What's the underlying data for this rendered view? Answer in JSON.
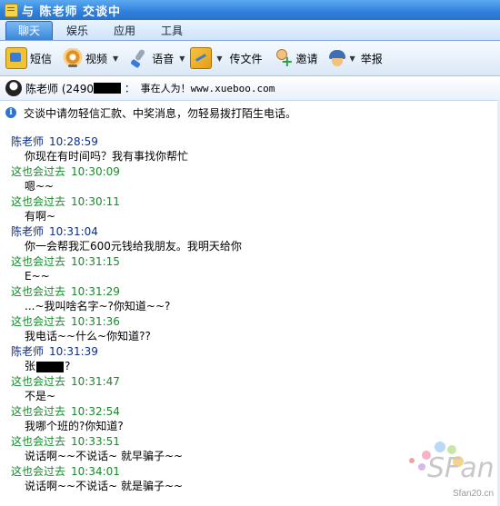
{
  "window": {
    "title": "与 陈老师 交谈中"
  },
  "tabs": [
    "聊天",
    "娱乐",
    "应用",
    "工具"
  ],
  "toolbar": {
    "sms": "短信",
    "video": "视频",
    "voice": "语音",
    "file": "传文件",
    "invite": "邀请",
    "report": "举报"
  },
  "contact": {
    "name_prefix": "陈老师 (2490",
    "sign": "：  事在人为！www.xueboo.com"
  },
  "warning": "交谈中请勿轻信汇款、中奖消息，勿轻易拨打陌生电话。",
  "colors": {
    "teacher": "#0a2e8a",
    "me": "#1a8a2e"
  },
  "messages": [
    {
      "sender": "陈老师",
      "time": "10:28:59",
      "side": "teacher",
      "text": "你现在有时间吗？我有事找你帮忙"
    },
    {
      "sender": "这也会过去",
      "time": "10:30:09",
      "side": "me",
      "text": "嗯~~"
    },
    {
      "sender": "这也会过去",
      "time": "10:30:11",
      "side": "me",
      "text": "有啊~"
    },
    {
      "sender": "陈老师",
      "time": "10:31:04",
      "side": "teacher",
      "text": "你一会帮我汇600元钱给我朋友。我明天给你"
    },
    {
      "sender": "这也会过去",
      "time": "10:31:15",
      "side": "me",
      "text": "E~~"
    },
    {
      "sender": "这也会过去",
      "time": "10:31:29",
      "side": "me",
      "text": "...~我叫啥名字~?你知道~~?"
    },
    {
      "sender": "这也会过去",
      "time": "10:31:36",
      "side": "me",
      "text": "我电话~~什么~你知道??"
    },
    {
      "sender": "陈老师",
      "time": "10:31:39",
      "side": "teacher",
      "text_prefix": "张",
      "text_suffix": "?"
    },
    {
      "sender": "这也会过去",
      "time": "10:31:47",
      "side": "me",
      "text": "不是~"
    },
    {
      "sender": "这也会过去",
      "time": "10:32:54",
      "side": "me",
      "text": "我哪个班的?你知道?"
    },
    {
      "sender": "这也会过去",
      "time": "10:33:51",
      "side": "me",
      "text": "说话啊~~不说话~ 就早骗子~~"
    },
    {
      "sender": "这也会过去",
      "time": "10:34:01",
      "side": "me",
      "text": "说话啊~~不说话~ 就是骗子~~"
    }
  ],
  "watermark": {
    "logo": "SFan",
    "site": "Sfan20.cn"
  }
}
